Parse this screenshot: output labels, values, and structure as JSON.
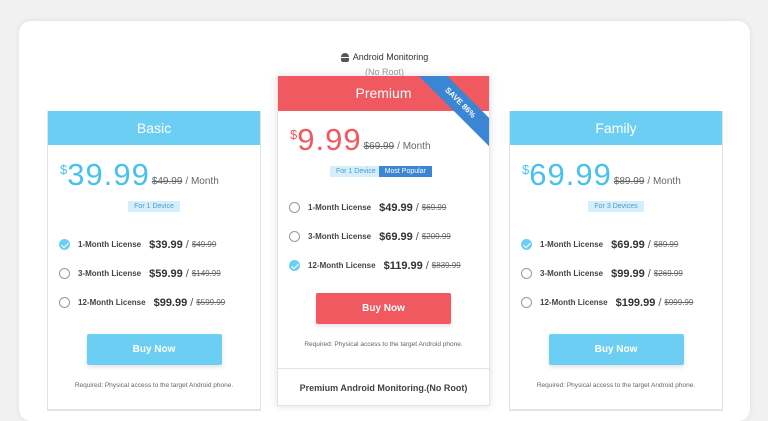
{
  "header": {
    "title": "Android Monitoring",
    "subtitle": "(No Root)"
  },
  "colors": {
    "blue": "#6dcef4",
    "red": "#f0595f",
    "ribbon": "#3b86d4"
  },
  "plans": {
    "basic": {
      "name": "Basic",
      "currency": "$",
      "price": "39.99",
      "old_price": "$49.99",
      "per": "/ Month",
      "devices": "For 1 Device",
      "options": [
        {
          "label": "1-Month License",
          "price": "$39.99",
          "old": "$49.99",
          "selected": true
        },
        {
          "label": "3-Month License",
          "price": "$59.99",
          "old": "$149.99",
          "selected": false
        },
        {
          "label": "12-Month License",
          "price": "$99.99",
          "old": "$599.99",
          "selected": false
        }
      ],
      "buy_label": "Buy Now",
      "requirement": "Required: Physical access to the target Android phone."
    },
    "premium": {
      "name": "Premium",
      "ribbon": "SAVE 86%",
      "currency": "$",
      "price": "9.99",
      "old_price": "$69.99",
      "per": "/ Month",
      "devices": "For 1 Device",
      "popular": "Most Popular",
      "options": [
        {
          "label": "1-Month License",
          "price": "$49.99",
          "old": "$69.99",
          "selected": false
        },
        {
          "label": "3-Month License",
          "price": "$69.99",
          "old": "$209.99",
          "selected": false
        },
        {
          "label": "12-Month License",
          "price": "$119.99",
          "old": "$839.99",
          "selected": true
        }
      ],
      "buy_label": "Buy Now",
      "requirement": "Required: Physical access to the target Android phone.",
      "footer_title": "Premium Android Monitoring.(No Root)"
    },
    "family": {
      "name": "Family",
      "currency": "$",
      "price": "69.99",
      "old_price": "$89.99",
      "per": "/ Month",
      "devices": "For 3 Devices",
      "options": [
        {
          "label": "1-Month License",
          "price": "$69.99",
          "old": "$89.99",
          "selected": true
        },
        {
          "label": "3-Month License",
          "price": "$99.99",
          "old": "$269.99",
          "selected": false
        },
        {
          "label": "12-Month License",
          "price": "$199.99",
          "old": "$999.99",
          "selected": false
        }
      ],
      "buy_label": "Buy Now",
      "requirement": "Required: Physical access to the target Android phone."
    }
  }
}
